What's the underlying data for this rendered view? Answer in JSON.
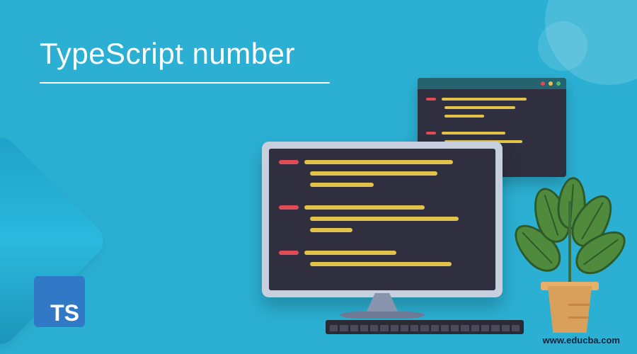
{
  "title": "TypeScript number",
  "logo": {
    "text": "TS"
  },
  "footer": {
    "url": "www.educba.com"
  },
  "colors": {
    "background": "#2bb0d3",
    "code_window": "#2f2f3f",
    "red_line": "#e14b55",
    "yellow_line": "#e2c24a",
    "ts_blue": "#3178c6"
  }
}
